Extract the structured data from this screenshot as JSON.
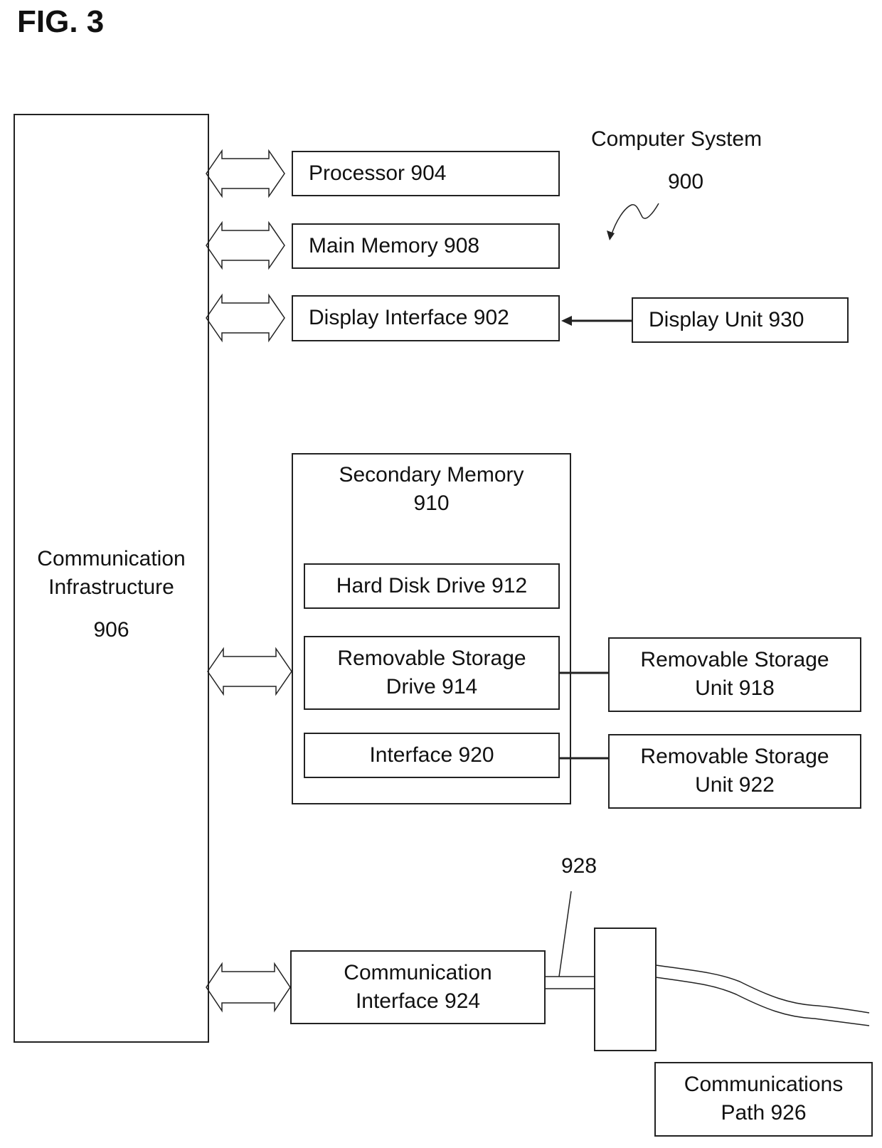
{
  "figure": {
    "title": "FIG. 3"
  },
  "system": {
    "name": "Computer System",
    "ref": "900"
  },
  "components": {
    "comm_infrastructure": {
      "line1": "Communication",
      "line2": "Infrastructure",
      "ref": "906"
    },
    "processor": {
      "label": "Processor 904"
    },
    "main_memory": {
      "label": "Main Memory 908"
    },
    "display_interface": {
      "label": "Display Interface 902"
    },
    "display_unit": {
      "label": "Display Unit 930"
    },
    "secondary_memory": {
      "line1": "Secondary Memory",
      "line2": "910"
    },
    "hard_disk_drive": {
      "label": "Hard Disk Drive 912"
    },
    "removable_storage_drive": {
      "line1": "Removable Storage",
      "line2": "Drive 914"
    },
    "interface": {
      "label": "Interface 920"
    },
    "removable_storage_unit_918": {
      "line1": "Removable Storage",
      "line2": "Unit 918"
    },
    "removable_storage_unit_922": {
      "line1": "Removable Storage",
      "line2": "Unit 922"
    },
    "communication_interface": {
      "line1": "Communication",
      "line2": "Interface 924"
    },
    "communications_path": {
      "line1": "Communications",
      "line2": "Path 926"
    },
    "channel_ref": "928"
  },
  "connections": [
    {
      "from": "comm_infrastructure",
      "to": "processor",
      "type": "bidirectional-block-arrow"
    },
    {
      "from": "comm_infrastructure",
      "to": "main_memory",
      "type": "bidirectional-block-arrow"
    },
    {
      "from": "comm_infrastructure",
      "to": "display_interface",
      "type": "bidirectional-block-arrow"
    },
    {
      "from": "display_unit",
      "to": "display_interface",
      "type": "arrow"
    },
    {
      "from": "comm_infrastructure",
      "to": "secondary_memory",
      "type": "bidirectional-block-arrow"
    },
    {
      "from": "removable_storage_drive",
      "to": "removable_storage_unit_918",
      "type": "line"
    },
    {
      "from": "interface",
      "to": "removable_storage_unit_922",
      "type": "line"
    },
    {
      "from": "comm_infrastructure",
      "to": "communication_interface",
      "type": "bidirectional-block-arrow"
    },
    {
      "from": "communication_interface",
      "to": "communications_path",
      "type": "channel"
    }
  ]
}
